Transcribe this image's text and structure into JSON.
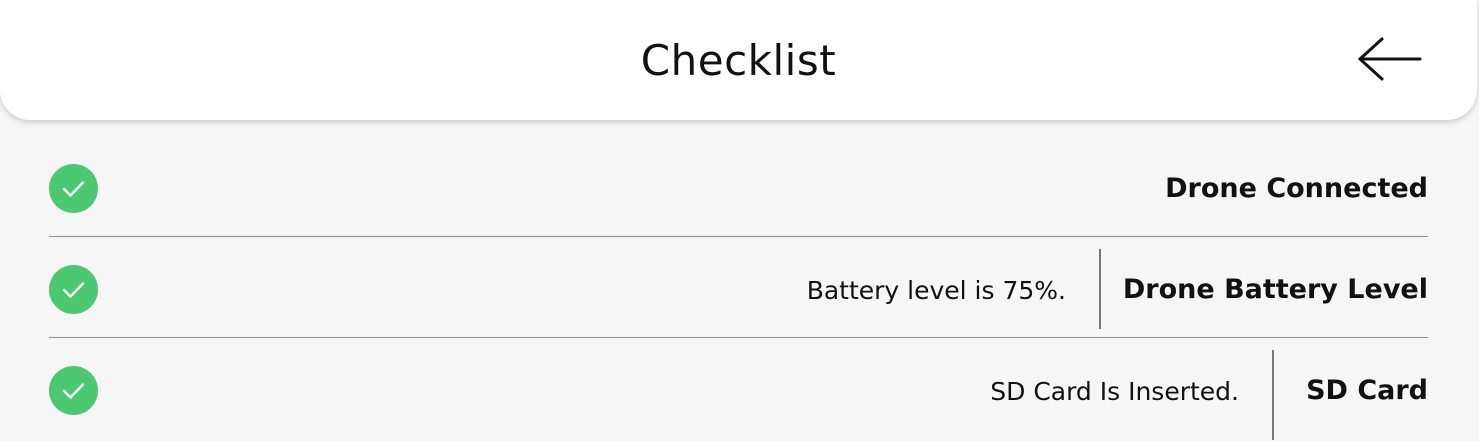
{
  "header": {
    "title": "Checklist",
    "back_icon": "arrow-left-icon"
  },
  "colors": {
    "check_green": "#4cc772",
    "background": "#f6f6f6",
    "header_background": "#ffffff"
  },
  "checklist": {
    "items": [
      {
        "title": "Drone Connected",
        "detail": "",
        "status": "ok",
        "icon": "check-circle-icon"
      },
      {
        "title": "Drone Battery Level",
        "detail": "Battery level is 75%.",
        "status": "ok",
        "icon": "check-circle-icon"
      },
      {
        "title": "SD Card",
        "detail": "SD Card Is Inserted.",
        "status": "ok",
        "icon": "check-circle-icon"
      }
    ]
  }
}
